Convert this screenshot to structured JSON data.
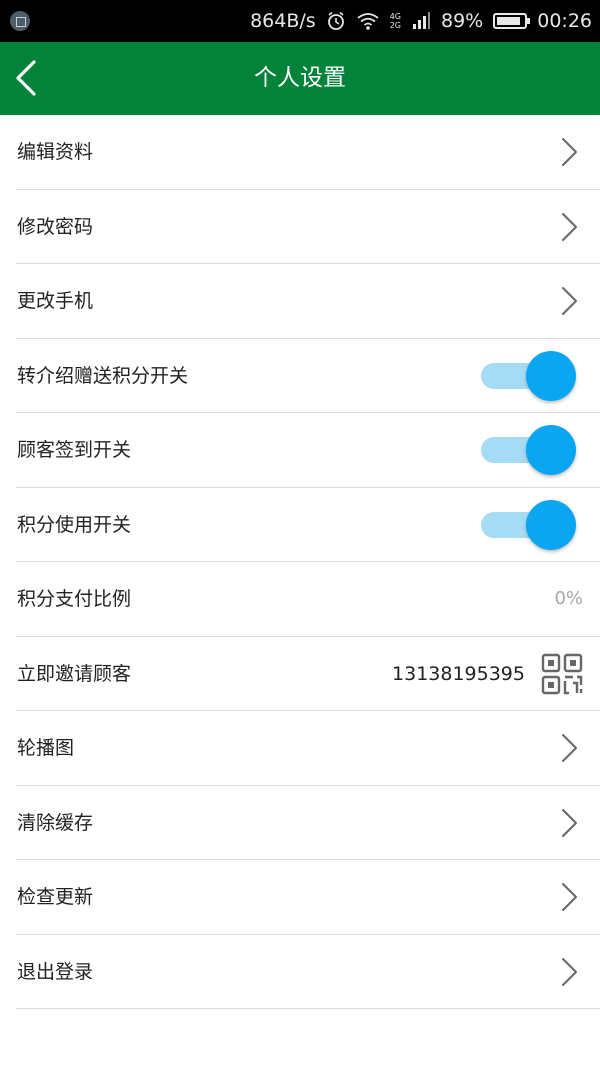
{
  "status_bar": {
    "network_speed": "864B/s",
    "network_type_1": "4G",
    "network_type_2": "2G",
    "battery_percent": "89%",
    "battery_level": 0.89,
    "time": "00:26",
    "icons": [
      "image-icon",
      "alarm-icon",
      "wifi-icon",
      "signal-icon",
      "battery-icon"
    ]
  },
  "app_bar": {
    "title": "个人设置",
    "background_color": "#03833a",
    "back_icon": "chevron-left-icon"
  },
  "settings": [
    {
      "label": "编辑资料",
      "type": "link"
    },
    {
      "label": "修改密码",
      "type": "link"
    },
    {
      "label": "更改手机",
      "type": "link"
    },
    {
      "label": "转介绍赠送积分开关",
      "type": "toggle",
      "on": true
    },
    {
      "label": "顾客签到开关",
      "type": "toggle",
      "on": true
    },
    {
      "label": "积分使用开关",
      "type": "toggle",
      "on": true
    },
    {
      "label": "积分支付比例",
      "type": "value",
      "value": "0%"
    },
    {
      "label": "立即邀请顾客",
      "type": "qr",
      "phone": "13138195395"
    },
    {
      "label": "轮播图",
      "type": "link"
    },
    {
      "label": "清除缓存",
      "type": "link"
    },
    {
      "label": "检查更新",
      "type": "link"
    },
    {
      "label": "退出登录",
      "type": "link"
    }
  ],
  "colors": {
    "toggle_knob": "#0aa6f2",
    "toggle_track": "#a6dbf5",
    "divider": "#dcdcdc"
  }
}
